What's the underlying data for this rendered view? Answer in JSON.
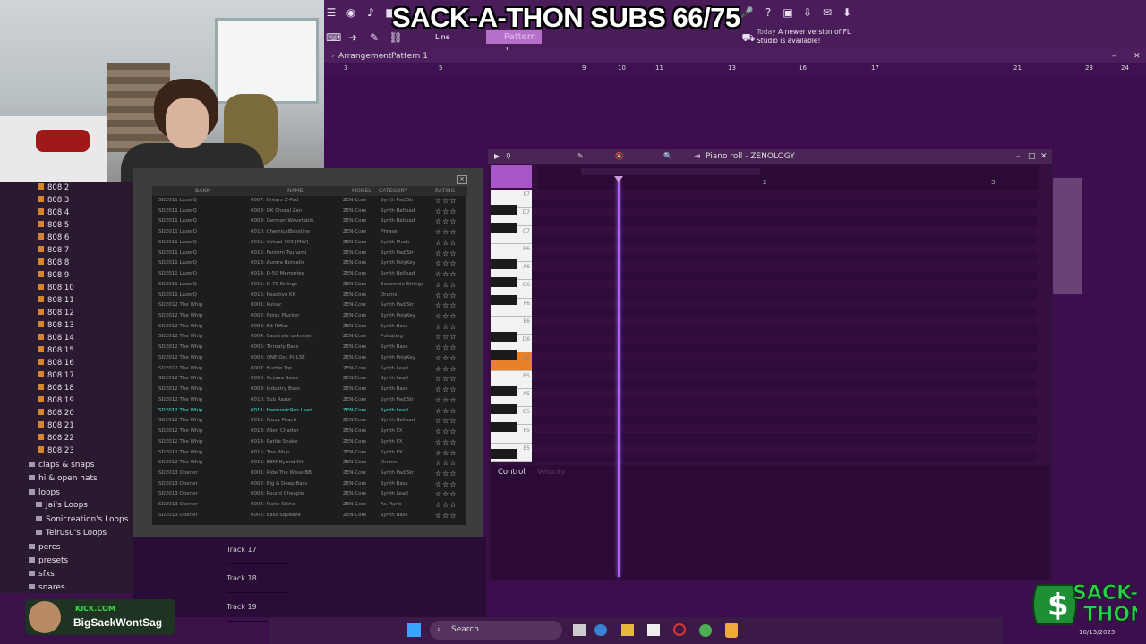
{
  "overlay": {
    "title": "SACK-A-THON SUBS 66/75"
  },
  "toolbar": {
    "line_mode": "Line",
    "pattern": "Pattern 1",
    "notice_today": "Today",
    "notice_text": "A newer version of FL Studio is available!"
  },
  "arrangement": {
    "breadcrumb_arrangement": "Arrangement",
    "breadcrumb_pattern": "Pattern 1",
    "bar_numbers": [
      "3",
      "5",
      "9",
      "10",
      "11",
      "13",
      "16",
      "17",
      "21",
      "23",
      "24"
    ]
  },
  "browser": {
    "items": [
      "808 2",
      "808 3",
      "808 4",
      "808 5",
      "808 6",
      "808 7",
      "808 8",
      "808 9",
      "808 10",
      "808 11",
      "808 12",
      "808 13",
      "808 14",
      "808 15",
      "808 16",
      "808 17",
      "808 18",
      "808 19",
      "808 20",
      "808 21",
      "808 22",
      "808 23"
    ],
    "folders": [
      "claps & snaps",
      "hi & open hats",
      "loops",
      "Jai's Loops",
      "Sonicreation's Loops",
      "Teirusu's Loops",
      "percs",
      "presets",
      "sfxs",
      "snares"
    ]
  },
  "preset_browser": {
    "headers": {
      "bank": "BANK",
      "name": "NAME",
      "model": "MODEL",
      "category": "CATEGORY",
      "rating": "RATING"
    },
    "rows": [
      {
        "bank": "SD2011 LazerQ",
        "name": "0007: Dream Z-Pad",
        "model": "ZEN-Core",
        "category": "Synth Pad/Str"
      },
      {
        "bank": "SD2011 LazerQ",
        "name": "0008: DK Choral Zen",
        "model": "ZEN-Core",
        "category": "Synth Bellpad"
      },
      {
        "bank": "SD2011 LazerQ",
        "name": "0009: German Wavetable",
        "model": "ZEN-Core",
        "category": "Synth Bellpad"
      },
      {
        "bank": "SD2011 LazerQ",
        "name": "0010: ChemicalBassline",
        "model": "ZEN-Core",
        "category": "Phrase"
      },
      {
        "bank": "SD2011 LazerQ",
        "name": "0011: Virtual 303 [MW]",
        "model": "ZEN-Core",
        "category": "Synth Pluck"
      },
      {
        "bank": "SD2011 LazerQ",
        "name": "0012: Fantom Tsunami",
        "model": "ZEN-Core",
        "category": "Synth Pad/Str"
      },
      {
        "bank": "SD2011 LazerQ",
        "name": "0013: Aurora Borealis",
        "model": "ZEN-Core",
        "category": "Synth PolyKey"
      },
      {
        "bank": "SD2011 LazerQ",
        "name": "0014: D-50 Memories",
        "model": "ZEN-Core",
        "category": "Synth Bellpad"
      },
      {
        "bank": "SD2011 LazerQ",
        "name": "0015: D-70 Strings",
        "model": "ZEN-Core",
        "category": "Ensemble Strings"
      },
      {
        "bank": "SD2011 LazerQ",
        "name": "0016: Reactive Kit",
        "model": "ZEN-Core",
        "category": "Drums"
      },
      {
        "bank": "SD2012 The Whip",
        "name": "0001: Pulsar",
        "model": "ZEN-Core",
        "category": "Synth Pad/Str"
      },
      {
        "bank": "SD2012 The Whip",
        "name": "0002: Noisy Plucker",
        "model": "ZEN-Core",
        "category": "Synth PolyKey"
      },
      {
        "bank": "SD2012 The Whip",
        "name": "0003: Bit Rifter",
        "model": "ZEN-Core",
        "category": "Synth Bass"
      },
      {
        "bank": "SD2012 The Whip",
        "name": "0004: Baudrate unknown",
        "model": "ZEN-Core",
        "category": "Pulsating"
      },
      {
        "bank": "SD2012 The Whip",
        "name": "0005: Throaty Bass",
        "model": "ZEN-Core",
        "category": "Synth Bass"
      },
      {
        "bank": "SD2012 The Whip",
        "name": "0006: ONE Osc PULSE",
        "model": "ZEN-Core",
        "category": "Synth PolyKey"
      },
      {
        "bank": "SD2012 The Whip",
        "name": "0007: Burble Top",
        "model": "ZEN-Core",
        "category": "Synth Lead"
      },
      {
        "bank": "SD2012 The Whip",
        "name": "0008: Octave Saws",
        "model": "ZEN-Core",
        "category": "Synth Lead"
      },
      {
        "bank": "SD2012 The Whip",
        "name": "0009: Industry Bass",
        "model": "ZEN-Core",
        "category": "Synth Bass"
      },
      {
        "bank": "SD2012 The Whip",
        "name": "0010: Sub Razor",
        "model": "ZEN-Core",
        "category": "Synth Pad/Str"
      },
      {
        "bank": "SD2012 The Whip",
        "name": "0011: HarmonicRez Lead",
        "model": "ZEN-Core",
        "category": "Synth Lead",
        "selected": true
      },
      {
        "bank": "SD2012 The Whip",
        "name": "0012: Fuzzy Peach",
        "model": "ZEN-Core",
        "category": "Synth Bellpad"
      },
      {
        "bank": "SD2012 The Whip",
        "name": "0013: Alien Chatter",
        "model": "ZEN-Core",
        "category": "Synth FX"
      },
      {
        "bank": "SD2012 The Whip",
        "name": "0014: Rattle Snake",
        "model": "ZEN-Core",
        "category": "Synth FX"
      },
      {
        "bank": "SD2012 The Whip",
        "name": "0015: The Whip",
        "model": "ZEN-Core",
        "category": "Synth FX"
      },
      {
        "bank": "SD2012 The Whip",
        "name": "0016: EBM Hybrid Kit",
        "model": "ZEN-Core",
        "category": "Drums"
      },
      {
        "bank": "SD2013 Opener",
        "name": "0001: Ride The Wave BB",
        "model": "ZEN-Core",
        "category": "Synth Pad/Str"
      },
      {
        "bank": "SD2013 Opener",
        "name": "0002: Big & Deep Bass",
        "model": "ZEN-Core",
        "category": "Synth Bass"
      },
      {
        "bank": "SD2013 Opener",
        "name": "0003: Round Cheapie",
        "model": "ZEN-Core",
        "category": "Synth Lead"
      },
      {
        "bank": "SD2013 Opener",
        "name": "0004: Piano Shine",
        "model": "ZEN-Core",
        "category": "Ac.Piano"
      },
      {
        "bank": "SD2013 Opener",
        "name": "0005: Bass Squeeze",
        "model": "ZEN-Core",
        "category": "Synth Bass"
      }
    ],
    "rating_stars": "☆☆☆"
  },
  "tracks": [
    "Track 17",
    "Track 18",
    "Track 19"
  ],
  "piano_roll": {
    "title": "Piano roll - ZENOLOGY",
    "ruler": [
      "2",
      "3"
    ],
    "note_labels": [
      "E7",
      "D7",
      "C7",
      "B6",
      "A6",
      "G6",
      "F6",
      "E6",
      "D6",
      "C6",
      "B5",
      "A5",
      "G5",
      "F5",
      "E5"
    ],
    "control_label": "Control",
    "velocity_label": "Velocity"
  },
  "taskbar": {
    "search": "Search",
    "date": "10/15/2025"
  },
  "kick": {
    "site": "KICK.COM",
    "user": "BigSackWontSag"
  },
  "colors": {
    "accent": "#b670c9",
    "selected_preset": "#3fe7c9",
    "highlight_key": "#e8822a"
  }
}
